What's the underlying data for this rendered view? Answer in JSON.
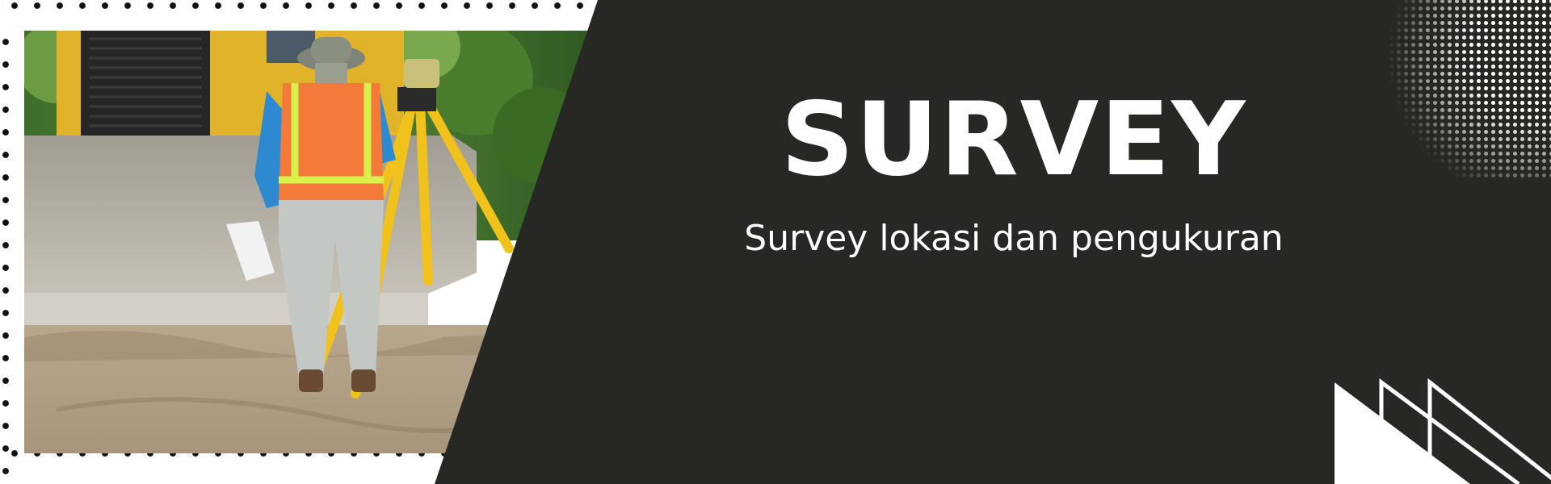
{
  "banner": {
    "title": "SURVEY",
    "subtitle": "Survey lokasi dan pengukuran"
  },
  "colors": {
    "panel": "#272823",
    "background": "#ffffff",
    "text": "#ffffff",
    "dots": "#111111",
    "vest": "#f47a3a",
    "tripod": "#f2c21c",
    "machine": "#e0b32a"
  },
  "photo": {
    "subject": "surveyor-with-tripod-at-construction-site"
  }
}
